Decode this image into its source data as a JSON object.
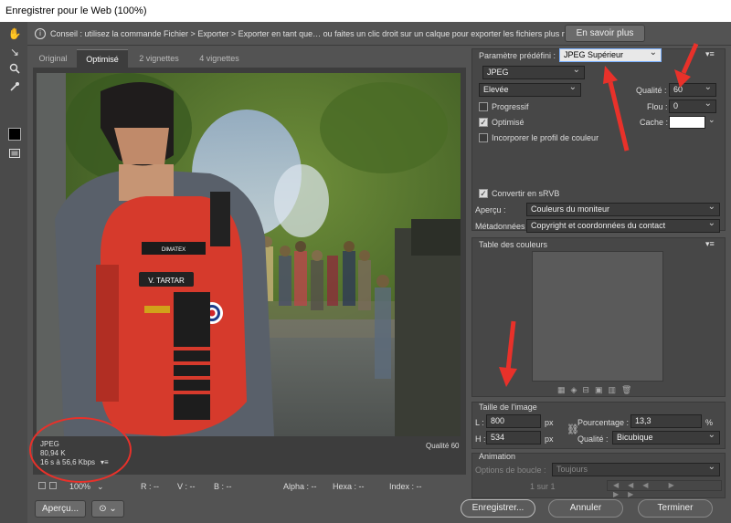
{
  "window": {
    "title": "Enregistrer pour le Web (100%)"
  },
  "tip": {
    "text": "Conseil : utilisez la commande Fichier > Exporter > Exporter en tant que… ou faites un clic droit sur un calque pour exporter les fichiers plus rapidement.",
    "more_label": "En savoir plus"
  },
  "tabs": [
    {
      "label": "Original"
    },
    {
      "label": "Optimisé"
    },
    {
      "label": "2 vignettes"
    },
    {
      "label": "4 vignettes"
    }
  ],
  "image_info": {
    "format": "JPEG",
    "size": "80,94 K",
    "time": "16 s à 56,6 Kbps",
    "quality": "Qualité 60",
    "menu": "▾≡"
  },
  "preset": {
    "label": "Paramètre prédéfini :",
    "value": "JPEG Supérieur"
  },
  "format": {
    "value": "JPEG"
  },
  "compression": {
    "value": "Elevée"
  },
  "quality": {
    "label": "Qualité :",
    "value": "60"
  },
  "blur": {
    "label": "Flou :",
    "value": "0"
  },
  "matte": {
    "label": "Cache :"
  },
  "options": {
    "progressive": "Progressif",
    "optimized": "Optimisé",
    "embed_profile": "Incorporer le profil de couleur",
    "convert_srgb": "Convertir en sRVB"
  },
  "preview": {
    "label": "Aperçu :",
    "value": "Couleurs du moniteur"
  },
  "metadata": {
    "label": "Métadonnées :",
    "value": "Copyright et coordonnées du contact"
  },
  "color_table": {
    "title": "Table des couleurs"
  },
  "image_size": {
    "title": "Taille de l'image",
    "w_label": "L :",
    "w_value": "800",
    "h_label": "H :",
    "h_value": "534",
    "unit": "px",
    "percent_label": "Pourcentage :",
    "percent_value": "13,3",
    "percent_unit": "%",
    "quality_label": "Qualité :",
    "quality_value": "Bicubique"
  },
  "animation": {
    "title": "Animation",
    "loop_label": "Options de boucle :",
    "loop_value": "Toujours",
    "frame": "1 sur 1"
  },
  "statusbar": {
    "zoom": "100%",
    "r": "R : --",
    "v": "V : --",
    "b": "B : --",
    "alpha": "Alpha : --",
    "hexa": "Hexa : --",
    "index": "Index : --"
  },
  "buttons": {
    "preview": "Aperçu...",
    "save": "Enregistrer...",
    "cancel": "Annuler",
    "done": "Terminer"
  },
  "photo": {
    "patch_name": "V. TARTAR",
    "brand": "DIMATEX"
  },
  "colors": {
    "accent_red": "#e8312a",
    "bag_red": "#d63a2c",
    "bg": "#535353"
  }
}
